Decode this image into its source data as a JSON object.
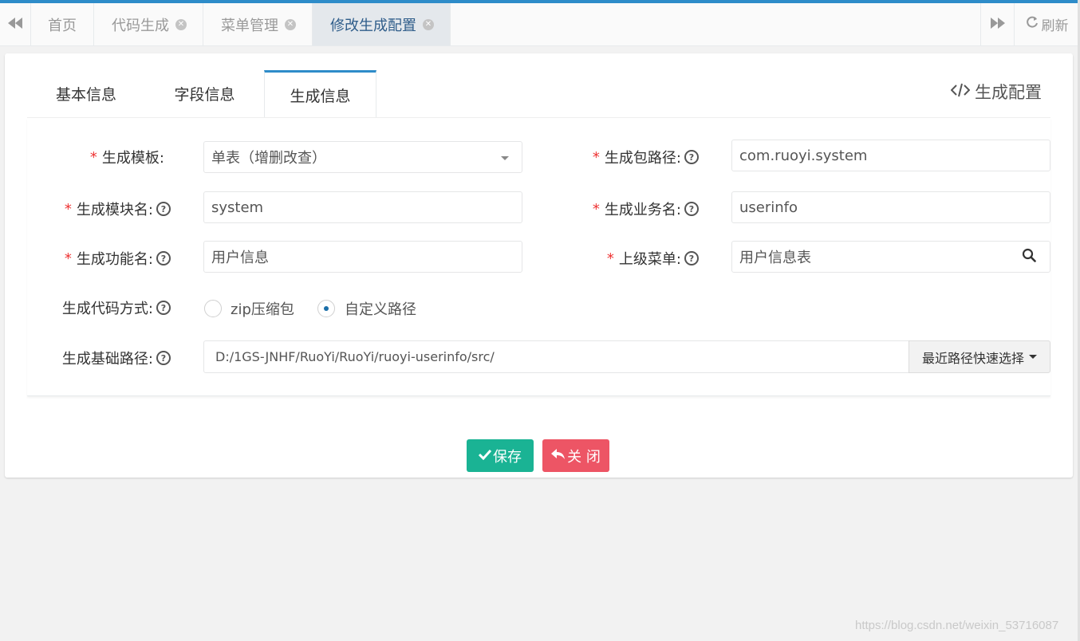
{
  "tabs": [
    {
      "label": "首页",
      "closable": false
    },
    {
      "label": "代码生成",
      "closable": true
    },
    {
      "label": "菜单管理",
      "closable": true
    },
    {
      "label": "修改生成配置",
      "closable": true,
      "active": true
    }
  ],
  "toolbar": {
    "refresh_label": "刷新"
  },
  "panel": {
    "tabs": [
      "基本信息",
      "字段信息",
      "生成信息"
    ],
    "active_tab": "生成信息",
    "title": "生成配置"
  },
  "form": {
    "template_label": "生成模板:",
    "template_value": "单表（增删改查）",
    "package_label": "生成包路径:",
    "package_value": "com.ruoyi.system",
    "module_label": "生成模块名:",
    "module_value": "system",
    "business_label": "生成业务名:",
    "business_value": "userinfo",
    "function_label": "生成功能名:",
    "function_value": "用户信息",
    "parent_menu_label": "上级菜单:",
    "parent_menu_value": "用户信息表",
    "gen_type_label": "生成代码方式:",
    "gen_type_options": [
      "zip压缩包",
      "自定义路径"
    ],
    "gen_type_selected": "自定义路径",
    "base_path_label": "生成基础路径:",
    "base_path_value": "D:/1GS-JNHF/RuoYi/RuoYi/ruoyi-userinfo/src/",
    "recent_path_label": "最近路径快速选择"
  },
  "actions": {
    "save_label": "保存",
    "close_label": "关 闭"
  },
  "watermark": "https://blog.csdn.net/weixin_53716087",
  "colors": {
    "accent": "#2e8cc9",
    "save": "#1ab394",
    "close": "#ed5565",
    "required": "#e33333"
  }
}
